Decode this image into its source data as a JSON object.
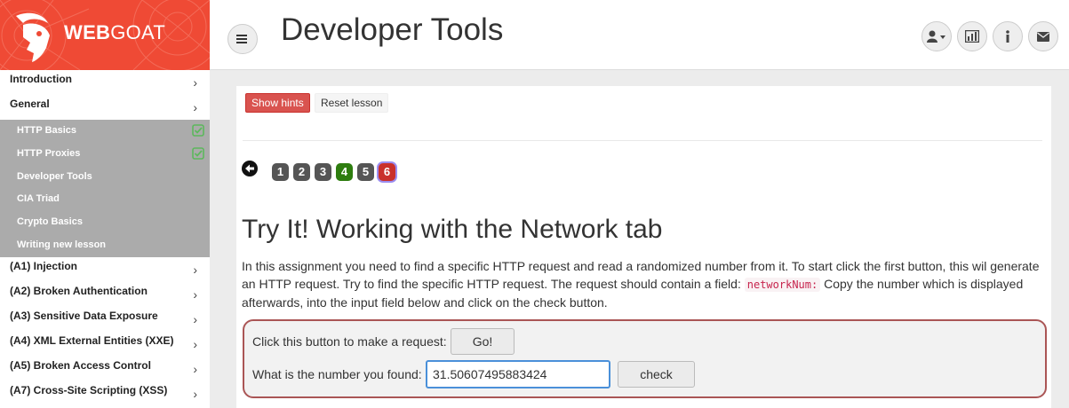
{
  "brand": {
    "name_bold": "WEB",
    "name_light": "GOAT"
  },
  "header": {
    "title": "Developer Tools"
  },
  "sidebar": {
    "items_top": [
      {
        "label": "Introduction"
      },
      {
        "label": "General"
      }
    ],
    "general_sub": [
      {
        "label": "HTTP Basics",
        "completed": true
      },
      {
        "label": "HTTP Proxies",
        "completed": true
      },
      {
        "label": "Developer Tools",
        "completed": false
      },
      {
        "label": "CIA Triad",
        "completed": false
      },
      {
        "label": "Crypto Basics",
        "completed": false
      },
      {
        "label": "Writing new lesson",
        "completed": false
      }
    ],
    "items_bottom": [
      {
        "label": "(A1) Injection"
      },
      {
        "label": "(A2) Broken Authentication"
      },
      {
        "label": "(A3) Sensitive Data Exposure"
      },
      {
        "label": "(A4) XML External Entities (XXE)"
      },
      {
        "label": "(A5) Broken Access Control"
      },
      {
        "label": "(A7) Cross-Site Scripting (XSS)"
      }
    ]
  },
  "toolbar": {
    "show_hints": "Show hints",
    "reset_lesson": "Reset lesson"
  },
  "pagination": [
    {
      "label": "1",
      "color": "#555555"
    },
    {
      "label": "2",
      "color": "#555555"
    },
    {
      "label": "3",
      "color": "#555555"
    },
    {
      "label": "4",
      "color": "#2e7d0f"
    },
    {
      "label": "5",
      "color": "#555555"
    },
    {
      "label": "6",
      "color": "#c9302c",
      "current": true
    }
  ],
  "lesson": {
    "title": "Try It! Working with the Network tab",
    "desc_part1": "In this assignment you need to find a specific HTTP request and read a randomized number from it. To start click the first button, this wil generate an HTTP request. Try to find the specific HTTP request. The request should contain a field: ",
    "desc_code": "networkNum:",
    "desc_part2": " Copy the number which is displayed afterwards, into the input field below and click on the check button."
  },
  "form": {
    "request_label": "Click this button to make a request:",
    "go_label": "Go!",
    "number_label": "What is the number you found:",
    "number_value": "31.50607495883424",
    "check_label": "check"
  },
  "colors": {
    "brand": "#ef4a35",
    "sidebar_sub_bg": "#ababab",
    "check_green": "#5cb85c"
  }
}
